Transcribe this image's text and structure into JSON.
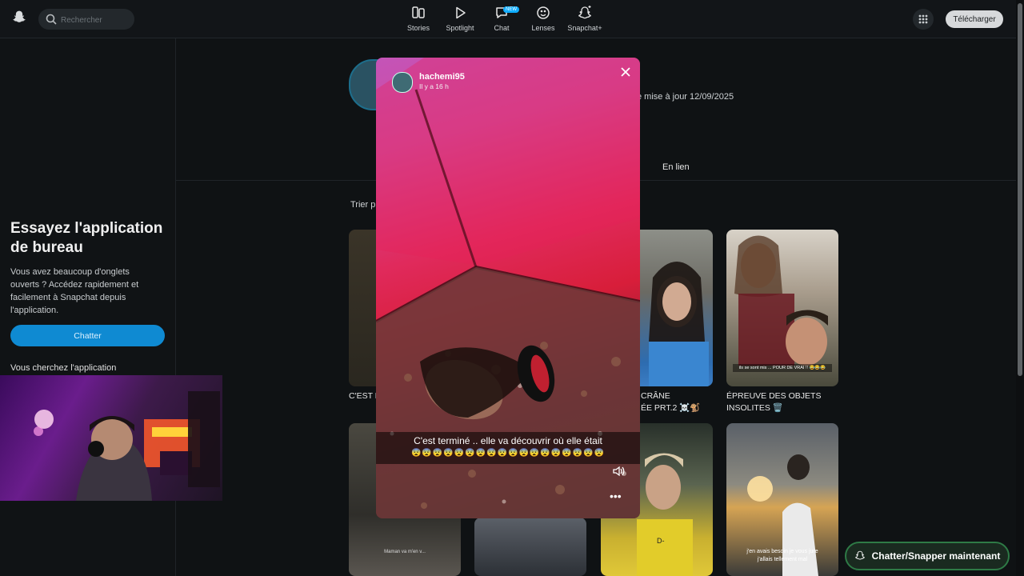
{
  "search": {
    "placeholder": "Rechercher"
  },
  "nav": [
    {
      "label": "Stories",
      "icon": "stories-icon"
    },
    {
      "label": "Spotlight",
      "icon": "spotlight-play-icon"
    },
    {
      "label": "Chat",
      "icon": "chat-icon",
      "badge": "NEW"
    },
    {
      "label": "Lenses",
      "icon": "lenses-icon"
    },
    {
      "label": "Snapchat+",
      "icon": "snapchat-plus-icon"
    }
  ],
  "header": {
    "download": "Télécharger"
  },
  "sidebar": {
    "title": "Essayez l'application de bureau",
    "text": "Vous avez beaucoup d'onglets ouverts ? Accédez rapidement et facilement à Snapchat depuis l'application.",
    "chat_button": "Chatter",
    "looking": "Vous cherchez l'application"
  },
  "profile": {
    "updated": "e mise à jour 12/09/2025",
    "tab_linked": "En lien",
    "sort": "Trier p"
  },
  "cards": {
    "c1_caption": "C'EST F",
    "c3_caption_line1": "CRÂNE",
    "c3_caption_line2": "ÉE PRT.2 ☠️🐒",
    "c4_caption_line1": "ÉPREUVE DES OBJETS",
    "c4_caption_line2": "INSOLITES 🗑️",
    "c4_overlay": "ils se sont mis ... POUR DE VRAI !! 😂😂😂",
    "c5_overlay": "Maman va m'en v...",
    "c8_overlay_line1": "j'en avais besoin je vous jure",
    "c8_overlay_line2": "j'allais tellement mal"
  },
  "story": {
    "username": "hachemi95",
    "time": "Il y a 16 h",
    "caption": "C'est terminé .. elle va découvrir où elle était",
    "emoji_line": "😨😨😨😨😨😨😨😨😨😨😨😨😨😨😨😨😨😨"
  },
  "cta": {
    "label": "Chatter/Snapper maintenant"
  }
}
